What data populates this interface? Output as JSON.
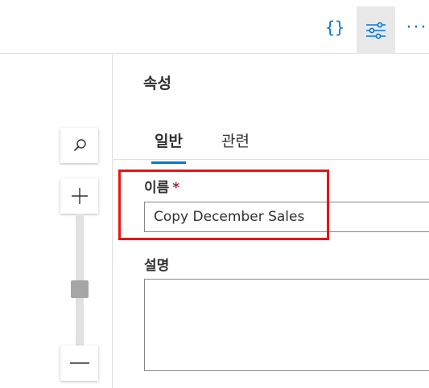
{
  "toolbar": {
    "code_icon": "{}",
    "settings_icon": "sliders-icon",
    "more_icon": "···"
  },
  "zoom": {
    "search_icon": "search-icon",
    "plus_icon": "plus-icon",
    "minus_icon": "minus-icon",
    "level": 0.5
  },
  "properties": {
    "title": "속성",
    "tabs": [
      {
        "label": "일반",
        "active": true
      },
      {
        "label": "관련",
        "active": false
      }
    ],
    "name_label": "이름",
    "required_mark": "*",
    "name_value": "Copy December Sales",
    "description_label": "설명",
    "description_value": ""
  },
  "colors": {
    "accent": "#0078d4",
    "required": "#a4262c",
    "highlight": "#ee1111"
  }
}
